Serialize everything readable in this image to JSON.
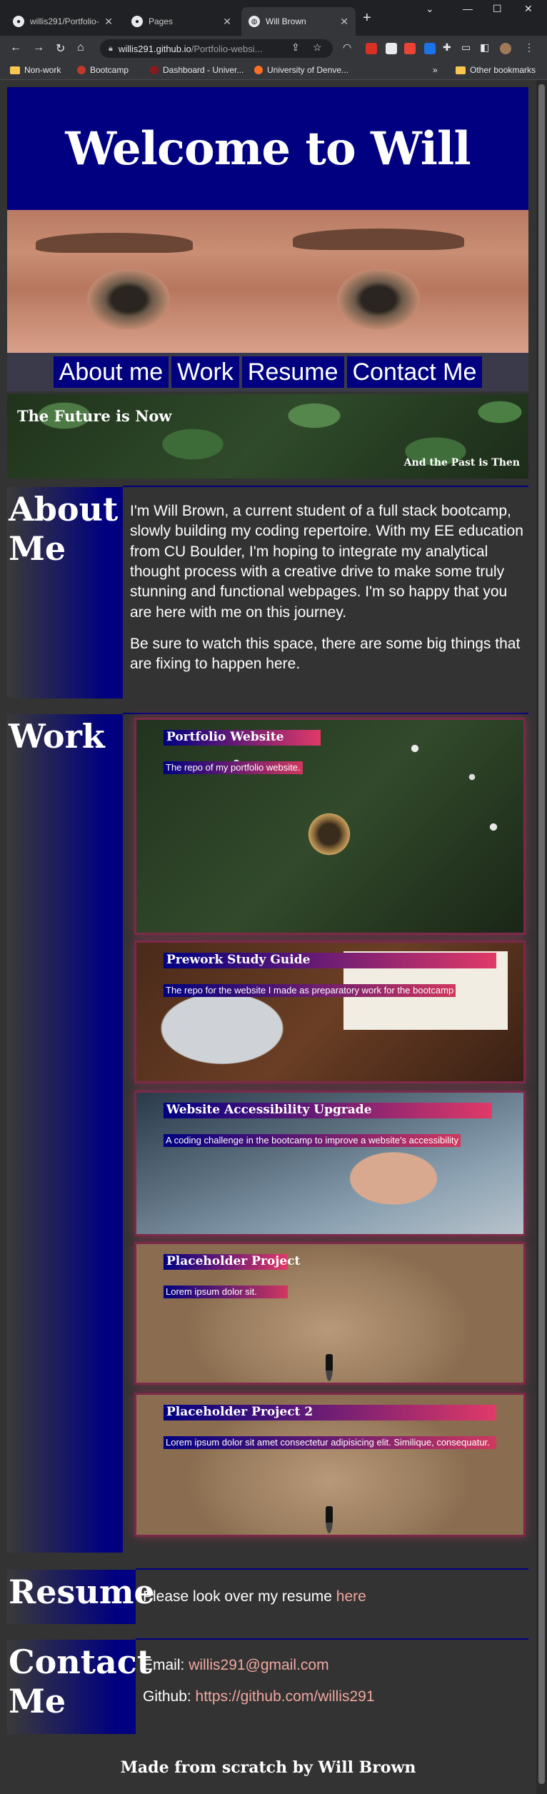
{
  "browser": {
    "tabs": [
      {
        "label": "willis291/Portfolio-",
        "icon": "github-icon"
      },
      {
        "label": "Pages",
        "icon": "github-icon"
      },
      {
        "label": "Will Brown",
        "icon": "globe-icon"
      }
    ],
    "address": {
      "host": "willis291.github.io",
      "path": "/Portfolio-websi..."
    },
    "bookmarks": [
      "Non-work",
      "Bootcamp",
      "Dashboard - Univer...",
      "University of Denve..."
    ],
    "other_bookmarks": "Other bookmarks"
  },
  "header": {
    "title": "Welcome to Will"
  },
  "nav": {
    "about": "About me",
    "work": "Work",
    "resume": "Resume",
    "contact": "Contact Me"
  },
  "banner": {
    "headline": "The Future is Now",
    "subline": "And the Past is Then"
  },
  "about": {
    "heading": "About Me",
    "paragraphs": [
      "I'm Will Brown, a current student of a full stack bootcamp, slowly building my coding repertoire. With my EE education from CU Boulder, I'm hoping to integrate my analytical thought process with a creative drive to make some truly stunning and functional webpages. I'm so happy that you are here with me on this journey.",
      "Be sure to watch this space, there are some big things that are fixing to happen here."
    ]
  },
  "work": {
    "heading": "Work",
    "projects": [
      {
        "title": "Portfolio Website",
        "desc": "The repo of my portfolio website."
      },
      {
        "title": "Prework Study Guide",
        "desc": "The repo for the website I made as preparatory work for the bootcamp"
      },
      {
        "title": "Website Accessibility Upgrade",
        "desc": "A coding challenge in the bootcamp to improve a website's accessibility"
      },
      {
        "title": "Placeholder Project",
        "desc": "Lorem ipsum dolor sit."
      },
      {
        "title": "Placeholder Project 2",
        "desc": "Lorem ipsum dolor sit amet consectetur adipisicing elit. Similique, consequatur."
      }
    ]
  },
  "resume": {
    "heading": "Resume",
    "text": "Please look over my resume ",
    "link": "here"
  },
  "contact": {
    "heading": "Contact Me",
    "email_label": "Email: ",
    "email": "willis291@gmail.com",
    "github_label": "Github: ",
    "github": "https://github.com/willis291"
  },
  "footer": {
    "text": "Made from scratch by Will Brown"
  }
}
